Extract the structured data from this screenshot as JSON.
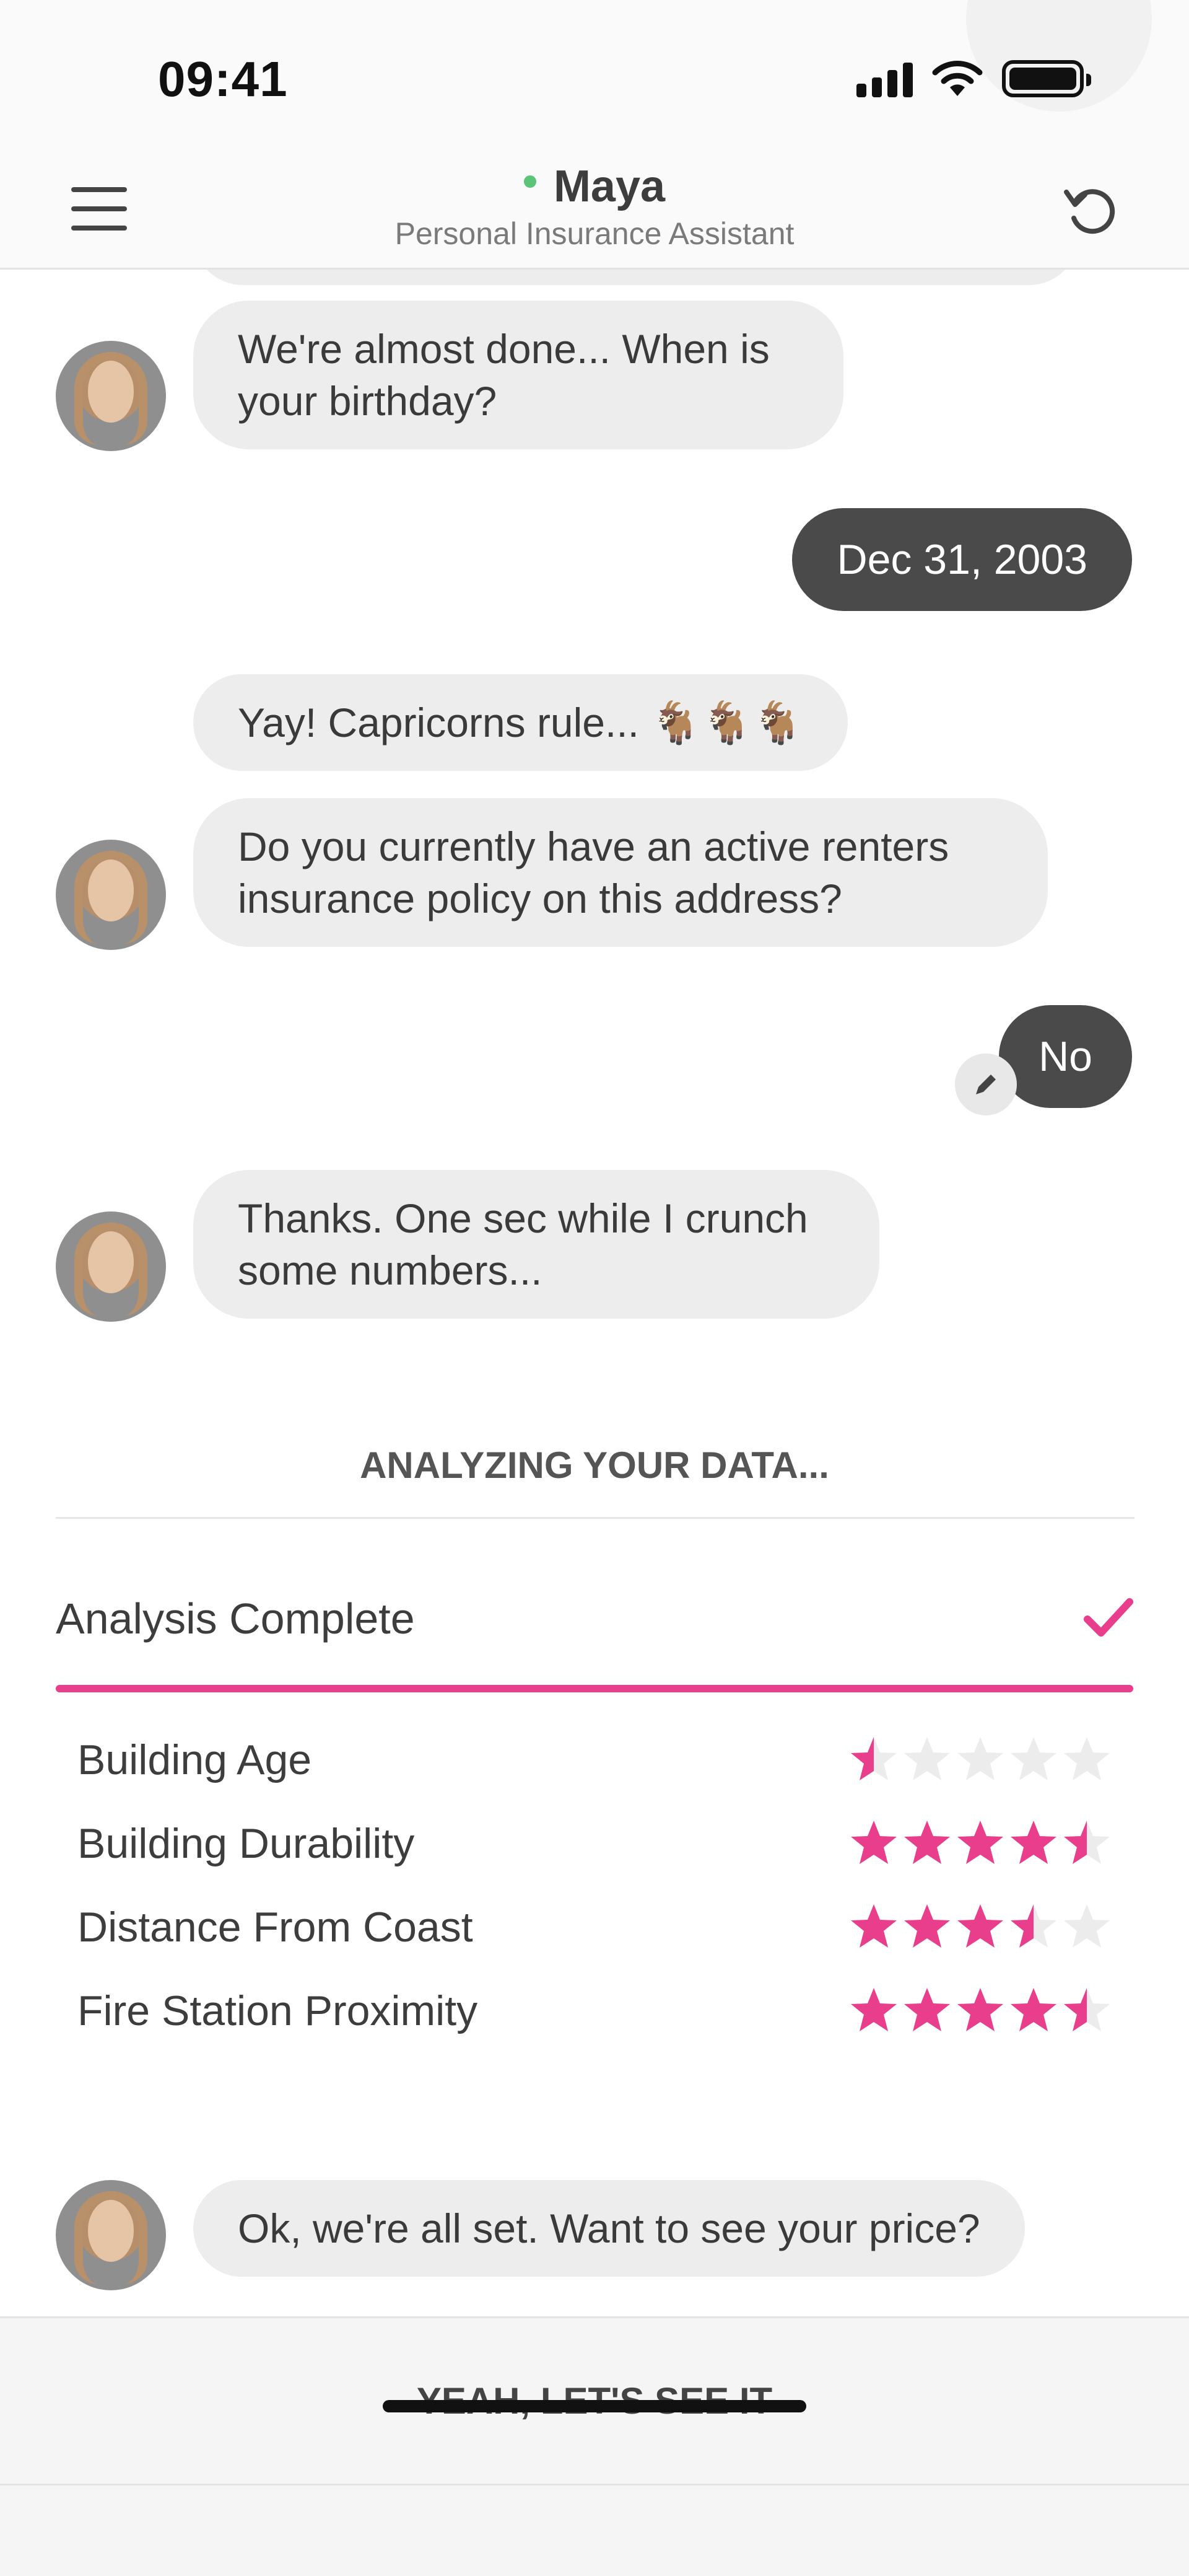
{
  "status_bar": {
    "time": "09:41"
  },
  "header": {
    "agent_name": "Maya",
    "agent_role": "Personal Insurance Assistant",
    "online_color": "#5cc478"
  },
  "messages": [
    {
      "from": "bot",
      "text": "We're almost done... When is your birthday?"
    },
    {
      "from": "user",
      "text": "Dec 31, 2003"
    },
    {
      "from": "bot",
      "text": "Yay! Capricorns rule... 🐐🐐🐐"
    },
    {
      "from": "bot",
      "text": "Do you currently have an active renters insurance policy on this address?"
    },
    {
      "from": "user",
      "text": "No",
      "editable": true
    },
    {
      "from": "bot",
      "text": "Thanks. One sec while I crunch some numbers..."
    },
    {
      "from": "bot",
      "text": "Ok, we're all set. Want to see your price?"
    }
  ],
  "analysis": {
    "title": "ANALYZING YOUR DATA...",
    "status": "Analysis Complete",
    "progress": 1.0,
    "accent_color": "#e83e8c",
    "ratings": [
      {
        "label": "Building Age",
        "stars": 0.5
      },
      {
        "label": "Building Durability",
        "stars": 4.5
      },
      {
        "label": "Distance From Coast",
        "stars": 3.5
      },
      {
        "label": "Fire Station Proximity",
        "stars": 4.5
      }
    ]
  },
  "cta": {
    "label": "YEAH, LET'S SEE IT"
  },
  "icons": {
    "menu": "hamburger-icon",
    "restart": "restart-icon",
    "edit": "pencil-icon",
    "check": "check-icon",
    "star": "star-icon"
  }
}
